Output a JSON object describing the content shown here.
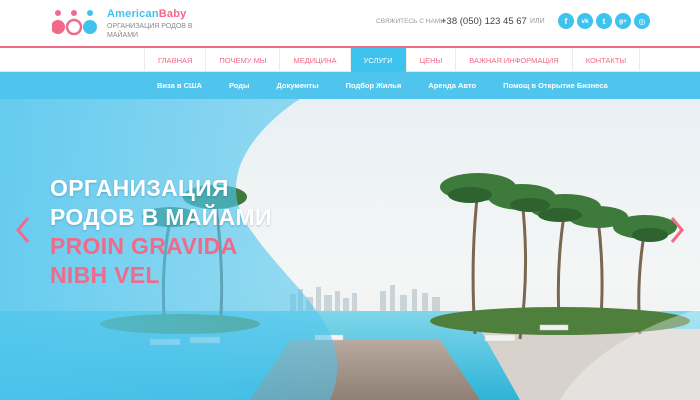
{
  "brand": {
    "name_part1": "American",
    "name_part2": "Baby",
    "subtitle": "ОРГАНИЗАЦИЯ РОДОВ В МАЙАМИ",
    "colors": {
      "blue": "#3ec3ee",
      "pink": "#f06a8a"
    }
  },
  "contact": {
    "label": "СВЯЖИТЕСЬ С НАМИ",
    "phone": "+38 (050) 123 45 67",
    "or": "ИЛИ"
  },
  "socials": [
    {
      "icon": "facebook-icon",
      "glyph": "f"
    },
    {
      "icon": "vk-icon",
      "glyph": "vk"
    },
    {
      "icon": "twitter-icon",
      "glyph": "t"
    },
    {
      "icon": "google-plus-icon",
      "glyph": "g+"
    },
    {
      "icon": "instagram-icon",
      "glyph": "◎"
    }
  ],
  "main_nav": [
    {
      "label": "ГЛАВНАЯ",
      "active": false
    },
    {
      "label": "ПОЧЕМУ МЫ",
      "active": false
    },
    {
      "label": "МЕДИЦИНА",
      "active": false
    },
    {
      "label": "УСЛУГИ",
      "active": true
    },
    {
      "label": "ЦЕНЫ",
      "active": false
    },
    {
      "label": "ВАЖНАЯ ИНФОРМАЦИЯ",
      "active": false
    },
    {
      "label": "КОНТАКТЫ",
      "active": false
    }
  ],
  "sub_nav": [
    "Виза в США",
    "Роды",
    "Документы",
    "Подбор Жилья",
    "Аренда Авто",
    "Помощ в Открытие Бизнеса"
  ],
  "hero": {
    "line1": "ОРГАНИЗАЦИЯ",
    "line2": "РОДОВ В МАЙАМИ",
    "line3": "PROIN GRAVIDA",
    "line4": "NIBH VEL",
    "prev_icon": "chevron-left-icon",
    "next_icon": "chevron-right-icon"
  }
}
